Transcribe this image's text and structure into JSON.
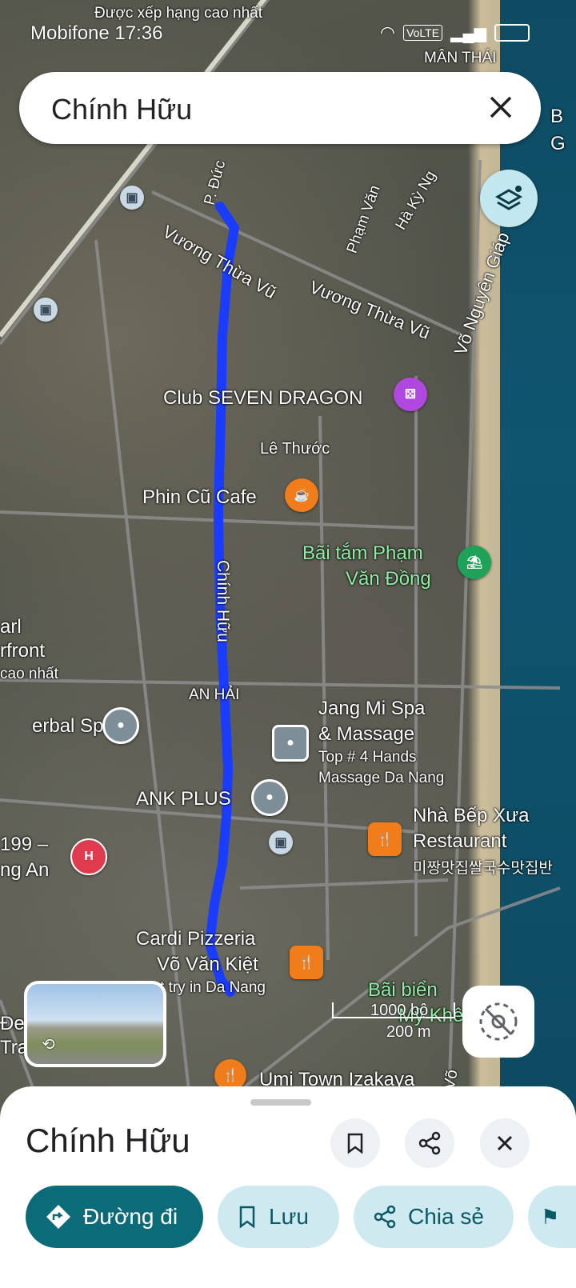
{
  "status_bar": {
    "carrier_time": "Mobifone 17:36",
    "network": "VoLTE"
  },
  "search": {
    "query": "Chính Hữu"
  },
  "map": {
    "road_labels": [
      "Vương Thừa Vũ",
      "Vương Thừa Vũ",
      "Võ Nguyên Giáp",
      "Phạm Văn",
      "Hà Kỳ Ng",
      "P. Đức",
      "Chính Hữu",
      "Lê Thước",
      "AN HẢI",
      "Võ"
    ],
    "places": {
      "club": "Club SEVEN DRAGON",
      "cafe": "Phin Cũ Cafe",
      "beach1_line1": "Bãi tắm Phạm",
      "beach1_line2": "Văn Đồng",
      "spa1_line1": "Jang Mi Spa",
      "spa1_line2": "& Massage",
      "spa1_sub1": "Top # 4 Hands",
      "spa1_sub2": "Massage Da Nang",
      "ank": "ANK PLUS",
      "restaurant_line1": "Nhà Bếp Xưa",
      "restaurant_line2": "Restaurant",
      "restaurant_sub": "미짱맛집쌀국수맛집반",
      "pizza_line1": "Cardi Pizzeria",
      "pizza_line2": "Võ Văn Kiệt",
      "pizza_sub": "t try in Da Nang",
      "beach2_line1": "Bãi biển",
      "beach2_line2": "Mỹ Khê",
      "umi": "Umi Town Izakaya",
      "herbal": "erbal Spa",
      "left_top1": "arl",
      "left_top2": "rfront",
      "left_top3": "cao nhất",
      "left_199": "199 –",
      "left_ng_an": "ng An",
      "left_de": "Đe",
      "left_tra": "Tra",
      "top_sub": "Được xếp hạng cao nhất",
      "man_thai": "MÂN THÁI",
      "right_b": "B",
      "right_g": "G"
    },
    "scale": {
      "feet": "1000 bộ",
      "meters": "200 m"
    },
    "colors": {
      "route": "#1a3cff",
      "pin_orange": "#f07c1a",
      "pin_purple": "#b048e0",
      "pin_green": "#1ea25a",
      "pin_red": "#e03a4e"
    }
  },
  "bottom_sheet": {
    "title": "Chính Hữu",
    "actions": [
      {
        "label": "Đường đi",
        "icon": "directions-icon"
      },
      {
        "label": "Lưu",
        "icon": "bookmark-icon"
      },
      {
        "label": "Chia sẻ",
        "icon": "share-icon"
      }
    ]
  }
}
